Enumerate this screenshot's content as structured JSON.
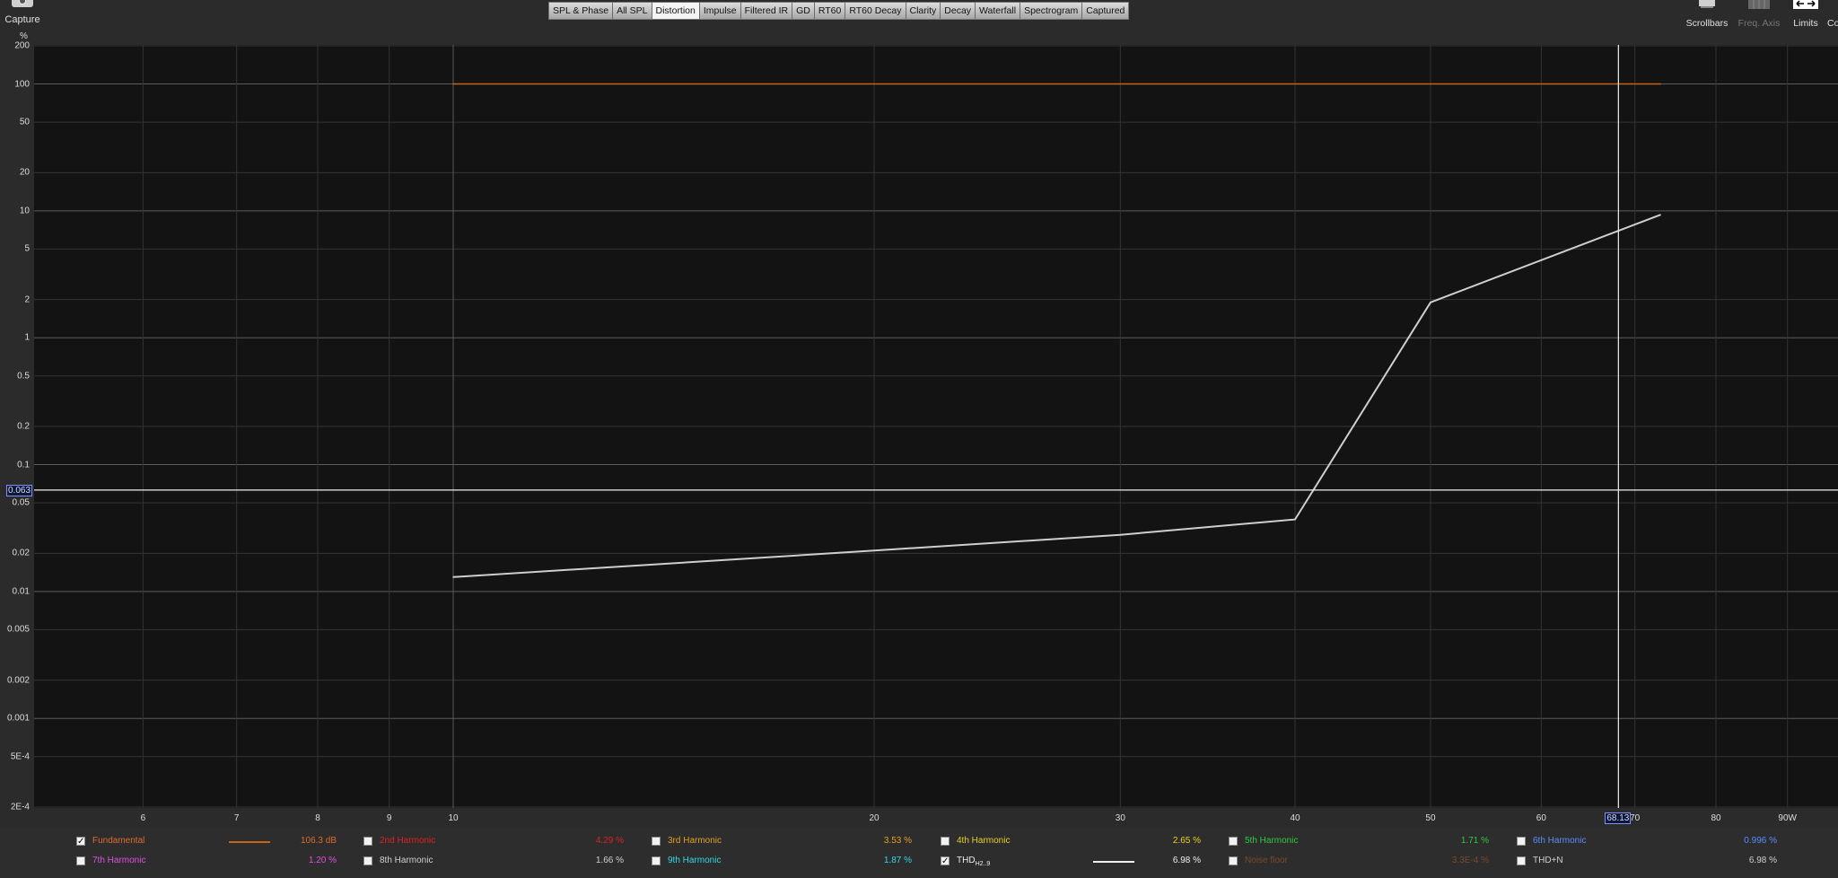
{
  "toolbar": {
    "capture_label": "Capture",
    "tabs": [
      "SPL & Phase",
      "All SPL",
      "Distortion",
      "Impulse",
      "Filtered IR",
      "GD",
      "RT60",
      "RT60 Decay",
      "Clarity",
      "Decay",
      "Waterfall",
      "Spectrogram",
      "Captured"
    ],
    "active_tab": "Distortion",
    "scrollbars_label": "Scrollbars",
    "freq_axis_label": "Freq. Axis",
    "limits_label": "Limits",
    "cut_label": "Co"
  },
  "chart_data": {
    "type": "line",
    "ylabel": "%",
    "yscale": "log",
    "xscale": "log",
    "ylim": [
      0.0002,
      200
    ],
    "xlim": [
      5.2,
      95
    ],
    "y_ticks": [
      "200",
      "100",
      "50",
      "20",
      "10",
      "5",
      "2",
      "1",
      "0.5",
      "0.2",
      "0.1",
      "0.05",
      "0.02",
      "0.01",
      "0.005",
      "0.002",
      "0.001",
      "5E-4",
      "2E-4"
    ],
    "x_ticks": [
      "6",
      "7",
      "8",
      "9",
      "10",
      "20",
      "30",
      "40",
      "50",
      "60",
      "70",
      "80",
      "90W"
    ],
    "series": [
      {
        "name": "Fundamental",
        "color": "#c86414",
        "x": [
          10,
          73
        ],
        "y": [
          100,
          100
        ]
      },
      {
        "name": "THD",
        "color": "#cfcfcf",
        "x": [
          10,
          20,
          30,
          40,
          50,
          73
        ],
        "y": [
          0.013,
          0.021,
          0.028,
          0.037,
          1.9,
          9.3
        ]
      }
    ],
    "cursor": {
      "x": 68.13,
      "x_label": "68.13",
      "y": 0.063,
      "y_label": "0.063"
    },
    "grid": true
  },
  "legend": {
    "items": [
      {
        "name": "Fundamental",
        "value": "106.3 dB",
        "color": "#e06a2a",
        "checked": true,
        "swatch": "#c86414"
      },
      {
        "name": "2nd Harmonic",
        "value": "4.29 %",
        "color": "#e02020",
        "checked": false
      },
      {
        "name": "3rd Harmonic",
        "value": "3.53 %",
        "color": "#e0a020",
        "checked": false
      },
      {
        "name": "4th Harmonic",
        "value": "2.65 %",
        "color": "#e8d020",
        "checked": false
      },
      {
        "name": "5th Harmonic",
        "value": "1.71 %",
        "color": "#30c840",
        "checked": false
      },
      {
        "name": "6th Harmonic",
        "value": "0.996 %",
        "color": "#5a8cff",
        "checked": false
      },
      {
        "name": "7th Harmonic",
        "value": "1.20 %",
        "color": "#e050e0",
        "checked": false
      },
      {
        "name": "8th Harmonic",
        "value": "1.66 %",
        "color": "#cfcfcf",
        "checked": false
      },
      {
        "name": "9th Harmonic",
        "value": "1.87 %",
        "color": "#30d8e8",
        "checked": false
      },
      {
        "name": "THD",
        "name_sub": "H2..9",
        "value": "6.98 %",
        "color": "#eeeeee",
        "checked": true,
        "swatch": "#eeeeee"
      },
      {
        "name": "Noise floor",
        "value": "3.3E-4 %",
        "color": "#7a4a2a",
        "checked": false
      },
      {
        "name": "THD+N",
        "value": "6.98 %",
        "color": "#cfcfcf",
        "checked": false
      }
    ]
  }
}
